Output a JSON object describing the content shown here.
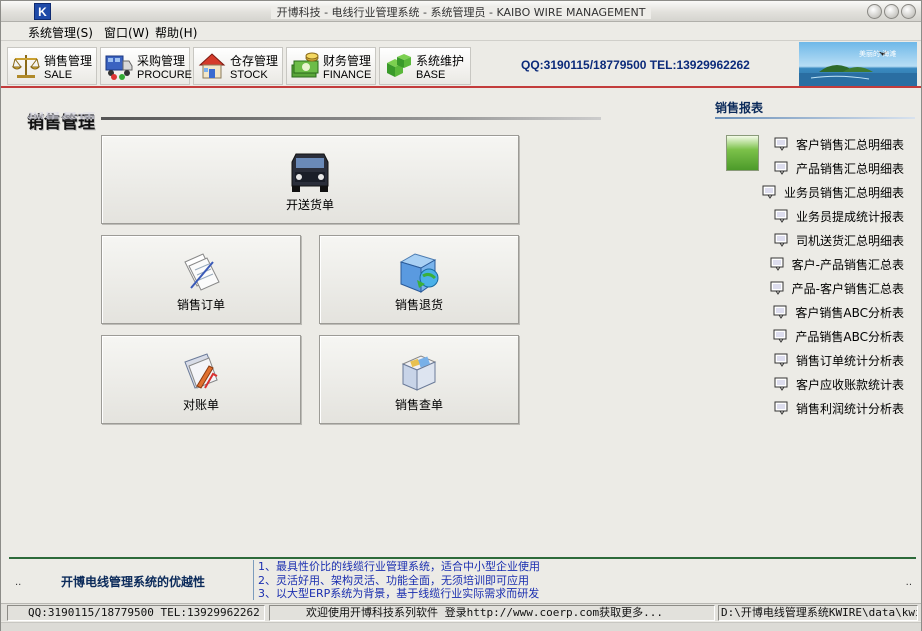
{
  "window": {
    "title": "开博科技 - 电线行业管理系统 - 系统管理员 - KAIBO WIRE MANAGEMENT",
    "app_icon": "K"
  },
  "menu": [
    {
      "label": "系统管理(S)"
    },
    {
      "label": "窗口(W)"
    },
    {
      "label": "帮助(H)"
    }
  ],
  "toolbar": {
    "buttons": [
      {
        "cn": "销售管理",
        "en": "SALE",
        "icon": "scales-icon"
      },
      {
        "cn": "采购管理",
        "en": "PROCURE",
        "icon": "truck-icon"
      },
      {
        "cn": "仓存管理",
        "en": "STOCK",
        "icon": "house-icon"
      },
      {
        "cn": "财务管理",
        "en": "FINANCE",
        "icon": "money-icon"
      },
      {
        "cn": "系统维护",
        "en": "BASE",
        "icon": "cubes-icon"
      }
    ],
    "contact": "QQ:3190115/18779500  TEL:13929962262",
    "banner_text": "美丽的 海滩"
  },
  "main": {
    "title": "销售管理",
    "buttons": {
      "delivery": "开送货单",
      "order": "销售订单",
      "return": "销售退货",
      "statement": "对账单",
      "query": "销售查单"
    }
  },
  "reports": {
    "title": "销售报表",
    "items": [
      "客户销售汇总明细表",
      "产品销售汇总明细表",
      "业务员销售汇总明细表",
      "业务员提成统计报表",
      "司机送货汇总明细表",
      "客户-产品销售汇总表",
      "产品-客户销售汇总表",
      "客户销售ABC分析表",
      "产品销售ABC分析表",
      "销售订单统计分析表",
      "客户应收账款统计表",
      "销售利润统计分析表"
    ]
  },
  "info": {
    "dots": "..",
    "heading": "开博电线管理系统的优越性",
    "lines": [
      "1、最具性价比的线缆行业管理系统，适合中小型企业使用",
      "2、灵活好用、架构灵活、功能全面，无须培训即可应用",
      "3、以大型ERP系统为背景，基于线缆行业实际需求而研发"
    ]
  },
  "status": {
    "contact": "QQ:3190115/18779500  TEL:13929962262",
    "welcome": "欢迎使用开博科技系列软件   登录http://www.coerp.com获取更多...",
    "path": "D:\\开博电线管理系统KWIRE\\data\\kwi"
  },
  "colors": {
    "accent_red": "#c33c3c",
    "title_blue": "#0b2a7a",
    "info_blue": "#1b2fb0",
    "divider_green": "#2d6a3a"
  }
}
